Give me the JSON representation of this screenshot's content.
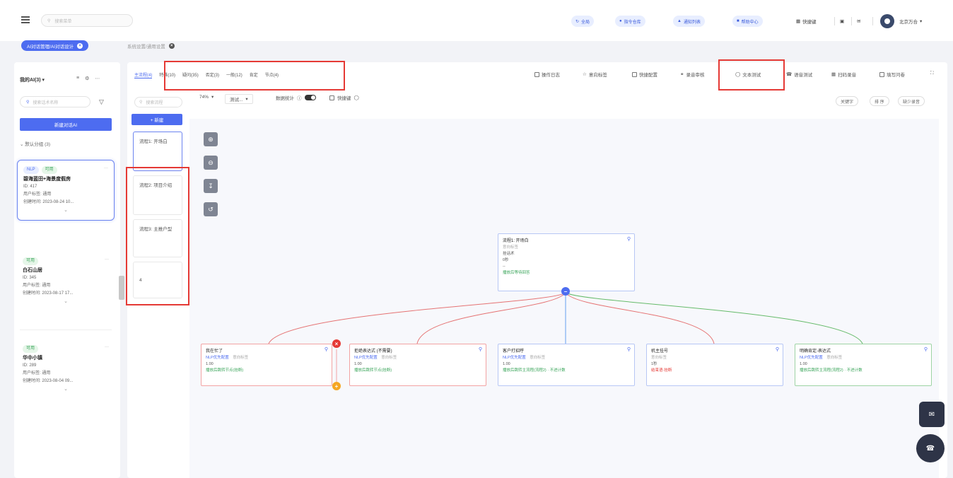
{
  "topbar": {
    "search_placeholder": "搜索菜单",
    "pills": [
      "全局",
      "指令仓库",
      "通知列表",
      "帮助中心"
    ],
    "shortcut": "快捷键",
    "user": "北京万合"
  },
  "crumbs": {
    "active": "AI对话管理/AI对话设计",
    "other": "系统设置/通用设置"
  },
  "sidebar": {
    "title": "我的AI(3)",
    "search_placeholder": "搜索话术名称",
    "new_button": "新建对话AI",
    "group": "默认分组 (3)",
    "cards": [
      {
        "tags": [
          "NLP",
          "可用"
        ],
        "name": "碧海蓝田+海景度假房",
        "id": "ID: 417",
        "user_tag": "用户标签: 通用",
        "created": "创建时间: 2023-08-24 10..."
      },
      {
        "tags": [
          "可用"
        ],
        "name": "白石山居",
        "id": "ID: 345",
        "user_tag": "用户标签: 通用",
        "created": "创建时间: 2023-08-17 17..."
      },
      {
        "tags": [
          "可用"
        ],
        "name": "华中小镇",
        "id": "ID: 289",
        "user_tag": "用户标签: 通用",
        "created": "创建时间: 2023-08-04 09..."
      }
    ]
  },
  "tabs": [
    "主流程(4)",
    "特殊(10)",
    "疑问(35)",
    "否定(3)",
    "一般(12)",
    "肯定",
    "节点(4)"
  ],
  "toolbar": [
    "操作日志",
    "意向标签",
    "快捷配置",
    "录音审核",
    "文本测试",
    "语音测试",
    "扫码录音",
    "填写问卷"
  ],
  "flow_list": {
    "search_placeholder": "搜索流程",
    "new_button": "+ 新建",
    "items": [
      "流程1: 开场白",
      "流程2: 项目介绍",
      "流程3: 主推户型",
      "4"
    ]
  },
  "canvas_ctl": {
    "zoom": "74%",
    "mode": "测试...",
    "stats": "数据统计",
    "shortcut": "快捷键",
    "right_buttons": [
      "关键字",
      "排 序",
      "缺少录音"
    ]
  },
  "nodes": {
    "root": {
      "title": "流程1: 开场白",
      "line1": "意向标签",
      "line2": "挂话术",
      "line3": "0秒",
      "line4": "--",
      "line5": "播放后等待回答"
    },
    "children": [
      {
        "title": "我在忙了",
        "tag": "NLP优先配置",
        "tag2": "意向标签",
        "t": "1.00",
        "desc": "播放后跳转节点(挂断)"
      },
      {
        "title": "拒绝表达式 (不需要)",
        "tag": "NLP优先配置",
        "tag2": "意向标签",
        "t": "1.00",
        "desc": "播放后跳转节点(挂断)"
      },
      {
        "title": "客户打招呼",
        "tag": "NLP优先配置",
        "tag2": "意向标签",
        "t": "1.00",
        "desc": "播放后跳转主流程(流程2) · 不进计数"
      },
      {
        "title": "机主挂号",
        "tag": "意向标签",
        "tag2": "",
        "t": "1秒",
        "desc": "结束语-挂断"
      },
      {
        "title": "明确肯定-表达式",
        "tag": "NLP优先配置",
        "tag2": "意向标签",
        "t": "1.00",
        "desc": "播放后跳转主流程(流程2) · 不进计数"
      }
    ]
  }
}
